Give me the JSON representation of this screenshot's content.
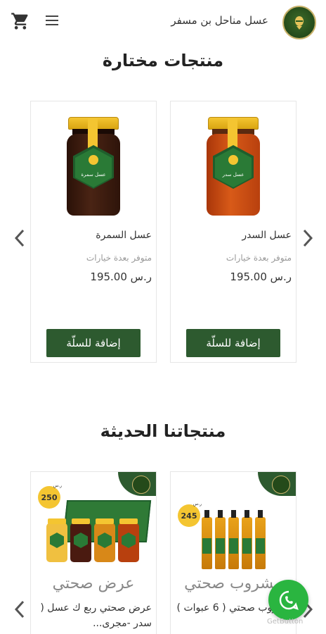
{
  "header": {
    "brand_name": "عسل مناحل بن مسفر",
    "cart_icon": "cart-icon",
    "menu_icon": "hamburger-menu-icon",
    "logo_icon": "brand-logo-icon"
  },
  "featured": {
    "title": "منتجات مختارة",
    "products": [
      {
        "name": "عسل السدر",
        "availability": "متوفر بعدة خيارات",
        "price": "195.00 ر.س",
        "button": "إضافة للسلّة",
        "label": "عسل سدر",
        "honey_color": "#c2470f"
      },
      {
        "name": "عسل السمرة",
        "availability": "متوفر بعدة خيارات",
        "price": "195.00 ر.س",
        "button": "إضافة للسلّة",
        "label": "عسل سمرة",
        "honey_color": "#3a1a10"
      }
    ]
  },
  "new_products": {
    "title": "منتجاتنا الحديثة",
    "products": [
      {
        "promo": "مشروب صحتي",
        "price": "245",
        "name": "مشروب صحتي ( 6 عبوات )"
      },
      {
        "promo": "عرض صحتي",
        "price": "250",
        "name": "عرض صحتي ربع ك عسل ( سدر -مجرى..."
      }
    ]
  },
  "currency_mini": "ر.س",
  "getbutton_label": "GetButton",
  "colors": {
    "primary_green": "#2d5a2f",
    "gold": "#f4c531",
    "whatsapp": "#2ab540"
  }
}
